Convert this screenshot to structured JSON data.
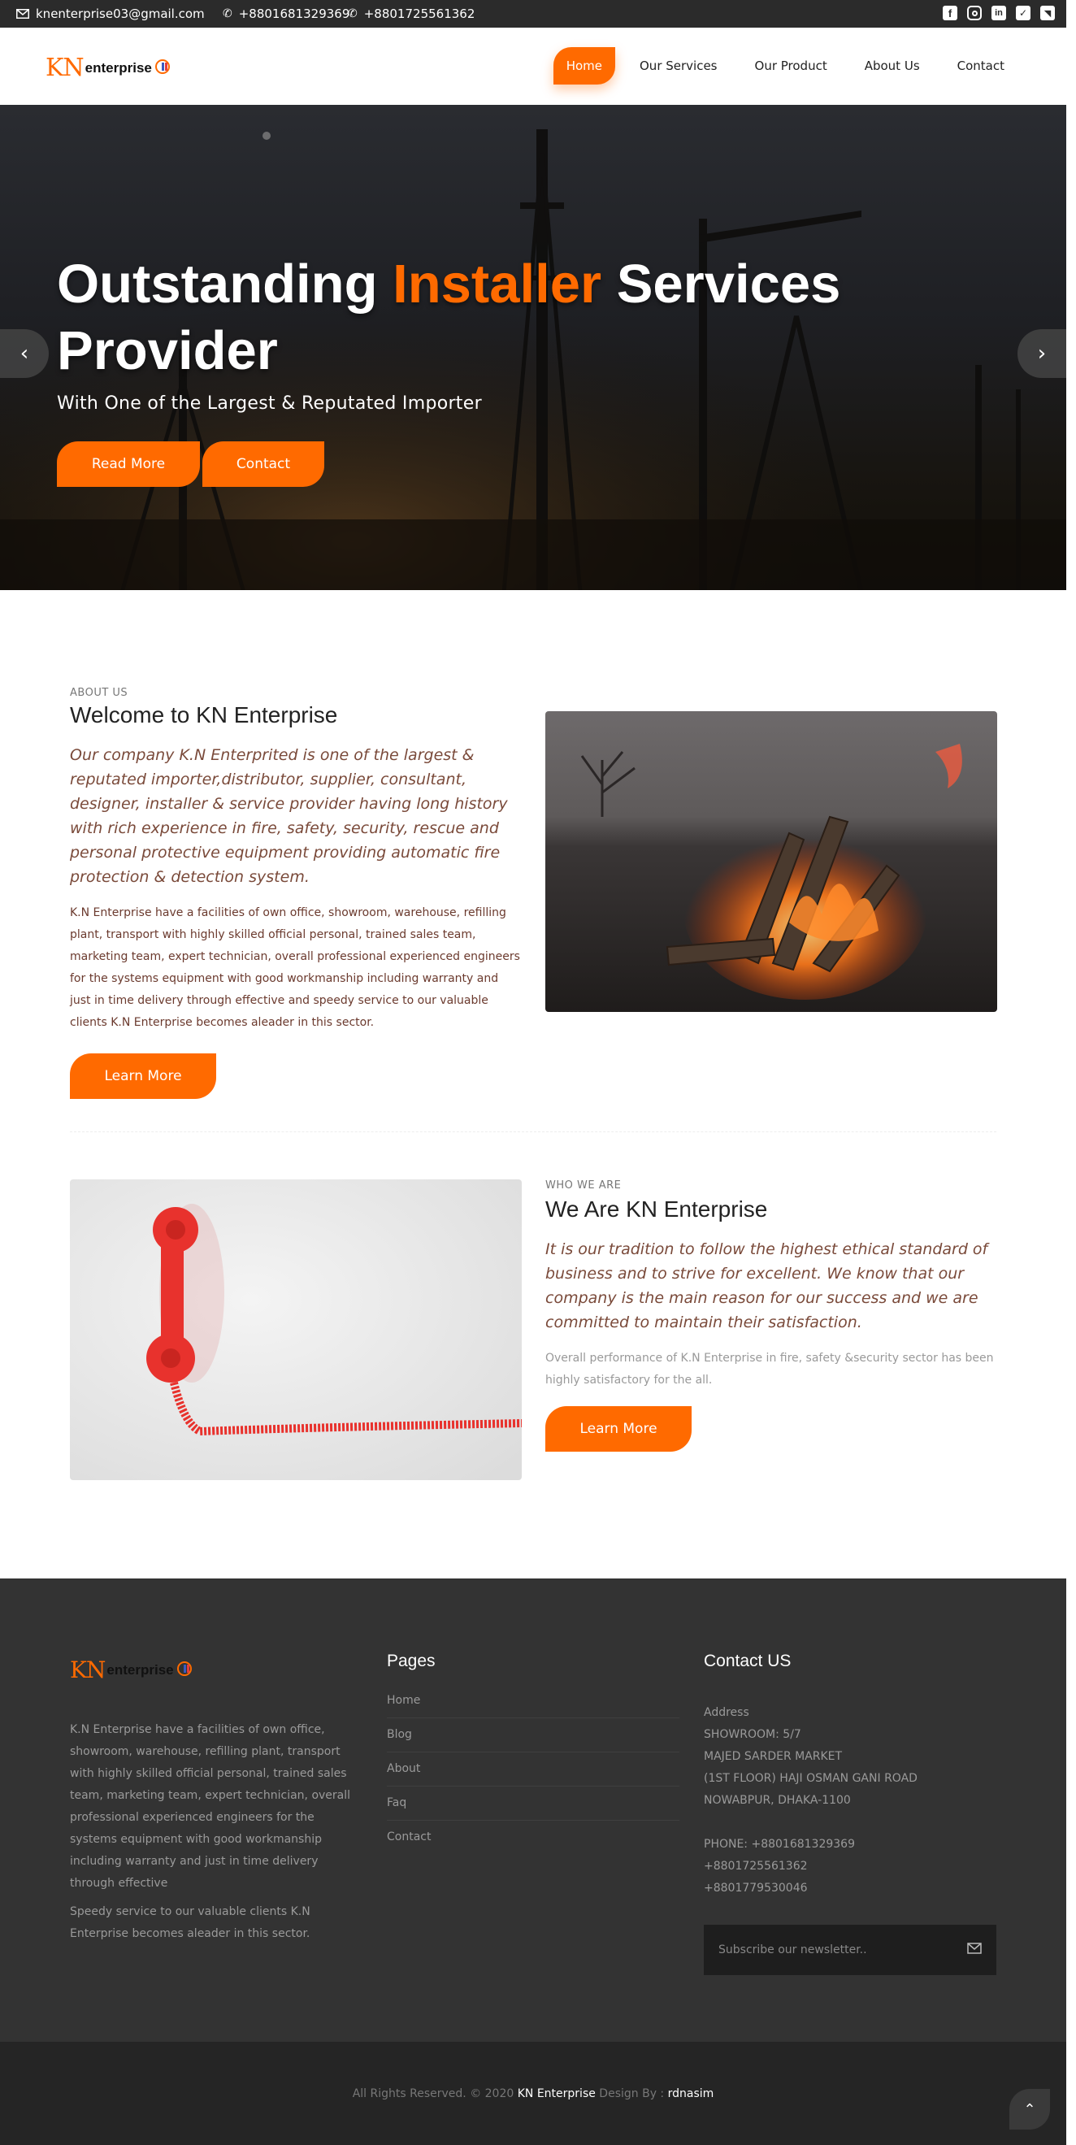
{
  "topbar": {
    "email": "knenterprise03@gmail.com",
    "phone1": "+8801681329369",
    "phone2": "+8801725561362",
    "social": [
      "facebook-icon",
      "instagram-icon",
      "linkedin-icon",
      "twitter-icon",
      "rss-icon"
    ]
  },
  "brand": {
    "logo_kn": "KN",
    "logo_text": "enterprise"
  },
  "nav": {
    "items": [
      {
        "label": "Home",
        "active": true
      },
      {
        "label": "Our Services"
      },
      {
        "label": "Our Product"
      },
      {
        "label": "About Us"
      },
      {
        "label": "Contact"
      }
    ]
  },
  "hero": {
    "title_part1": "Outstanding ",
    "title_highlight": "Installer",
    "title_part2": " Services Provider",
    "subtitle": "With One of the Largest & Reputated Importer",
    "btn_read_more": "Read More",
    "btn_contact": "Contact"
  },
  "about": {
    "kicker": "ABOUT US",
    "title": "Welcome to KN Enterprise",
    "lead": "Our company K.N Enterprited is one of the largest & reputated importer,distributor, supplier, consultant, designer, installer & service provider having long history with rich experience in fire, safety, security, rescue and personal protective equipment providing automatic fire protection & detection system.",
    "body": "K.N Enterprise have a facilities of own office, showroom, warehouse, refilling plant, transport with highly skilled official personal, trained sales team, marketing team, expert technician, overall professional experienced engineers for the systems equipment with good workmanship including warranty and just in time delivery through effective and speedy service to our valuable clients K.N Enterprise becomes aleader in this sector.",
    "button": "Learn More"
  },
  "who": {
    "kicker": "WHO WE ARE",
    "title": "We Are KN Enterprise",
    "lead": "It is our tradition to follow the highest ethical standard of business and to strive for excellent. We know that our company is the main reason for our success and we are committed to maintain their satisfaction.",
    "body": "Overall performance of K.N Enterprise in fire, safety &security sector has been highly satisfactory for the all.",
    "button": "Learn More"
  },
  "footer": {
    "about_p1": "K.N Enterprise have a facilities of own office, showroom, warehouse, refilling plant, transport with highly skilled official personal, trained sales team, marketing team, expert technician, overall professional experienced engineers for the systems equipment with good workmanship including warranty and just in time delivery through effective",
    "about_p2": "Speedy service to our valuable clients K.N Enterprise becomes aleader in this sector.",
    "pages_title": "Pages",
    "pages": [
      "Home",
      "Blog",
      "About",
      "Faq",
      "Contact"
    ],
    "contact_title": "Contact US",
    "address_label": "Address",
    "address_lines": [
      "SHOWROOM: 5/7",
      "MAJED SARDER MARKET",
      "(1ST FLOOR) HAJI OSMAN GANI ROAD",
      "NOWABPUR, DHAKA-1100"
    ],
    "phone_lines": [
      "PHONE: +8801681329369",
      "+8801725561362",
      "+8801779530046"
    ],
    "newsletter_placeholder": "Subscribe our newsletter..",
    "copyright_prefix": "All Rights Reserved. © 2020 ",
    "copyright_brand": "KN Enterprise",
    "design_by": " Design By : ",
    "designer": "rdnasim"
  },
  "colors": {
    "accent": "#ff6a00",
    "topbar": "#2b2b2b",
    "footer": "#333333",
    "bottom": "#252525"
  }
}
